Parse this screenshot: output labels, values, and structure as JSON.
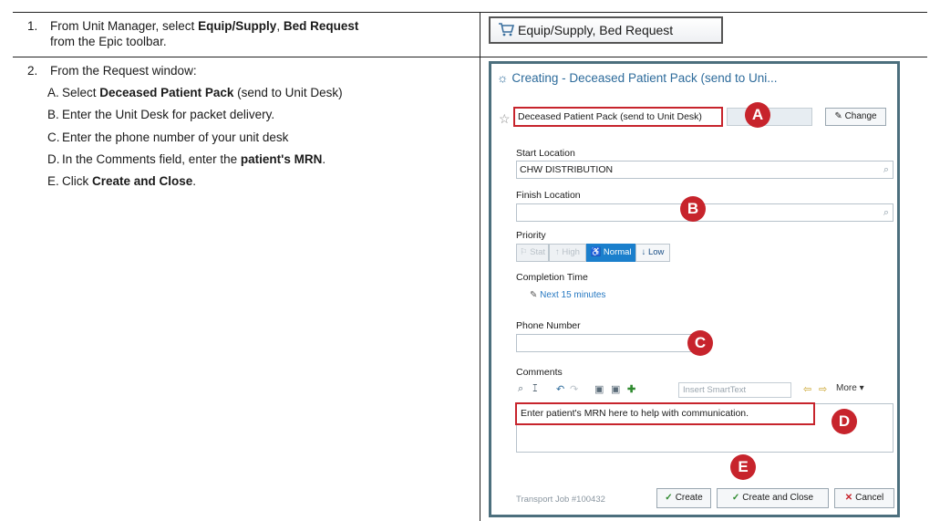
{
  "steps": [
    {
      "num": "1.",
      "line1_pre": "From Unit Manager, select ",
      "line1_bold": "Equip/Supply",
      "line1_mid": ", ",
      "line1_bold2": "Bed Request",
      "line2": "from the Epic toolbar."
    },
    {
      "num": "2.",
      "line1": "From the Request window:",
      "subs": [
        {
          "letter": "A.",
          "pre": "Select ",
          "bold": "Deceased Patient Pack",
          "post": " (send to Unit Desk)"
        },
        {
          "letter": "B.",
          "text": "Enter the Unit Desk for packet delivery."
        },
        {
          "letter": "C.",
          "text": "Enter the phone number of your unit desk"
        },
        {
          "letter": "D.",
          "pre": "In the Comments field, enter the ",
          "bold": "patient's MRN",
          "post": "."
        },
        {
          "letter": "E.",
          "pre": "Click ",
          "bold": "Create and Close",
          "post": "."
        }
      ]
    }
  ],
  "toolbar_button": {
    "label": "Equip/Supply, Bed Request",
    "icon": "cart-icon"
  },
  "window": {
    "title": "Creating - Deceased Patient Pack (send to Uni...",
    "request_type": "Deceased Patient Pack (send to Unit Desk)",
    "change_label": "Change",
    "start_location_label": "Start Location",
    "start_location_value": "CHW DISTRIBUTION",
    "finish_location_label": "Finish Location",
    "finish_location_value": "",
    "priority_label": "Priority",
    "priority_options": [
      "Stat",
      "High",
      "Normal",
      "Low"
    ],
    "priority_selected": "Normal",
    "completion_time_label": "Completion Time",
    "completion_time_value": "Next 15 minutes",
    "phone_label": "Phone Number",
    "phone_value": "",
    "comments_label": "Comments",
    "insert_smarttext": "Insert SmartText",
    "more_label": "More",
    "comments_value": "Enter patient's MRN here to help with communication.",
    "job_number": "Transport Job #100432",
    "create_label": "Create",
    "create_close_label": "Create and Close",
    "cancel_label": "Cancel"
  },
  "callouts": [
    "A",
    "B",
    "C",
    "D",
    "E"
  ],
  "colors": {
    "callout": "#c7242c",
    "window_border": "#4c6f7d",
    "title": "#2d6b9b",
    "selected_priority": "#1b7fcc"
  }
}
